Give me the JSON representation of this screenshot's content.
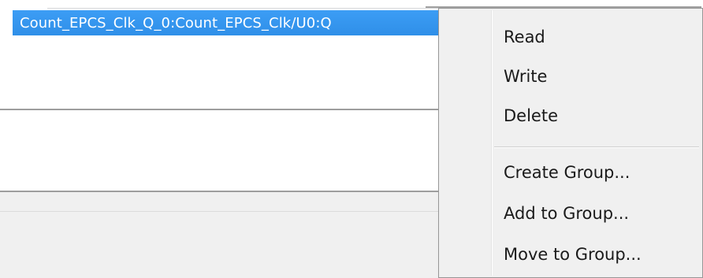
{
  "tree": {
    "selected_signal": "Count_EPCS_Clk_Q_0:Count_EPCS_Clk/U0:Q"
  },
  "context_menu": {
    "items": [
      {
        "label": "Read"
      },
      {
        "label": "Write"
      },
      {
        "label": "Delete"
      },
      {
        "label": "Create Group..."
      },
      {
        "label": "Add to Group..."
      },
      {
        "label": "Move to Group..."
      }
    ]
  },
  "colors": {
    "selection": "#3399ff",
    "menu_background": "#f0f0f0"
  }
}
